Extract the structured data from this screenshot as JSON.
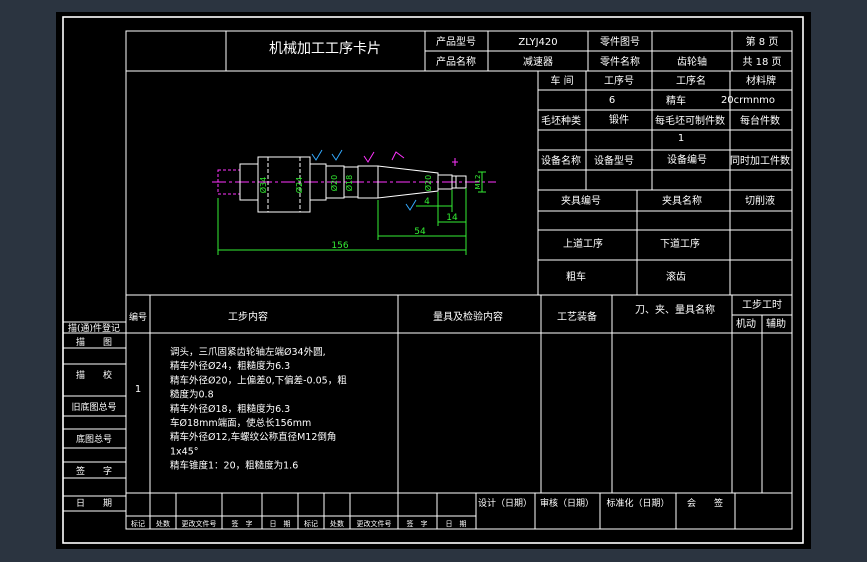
{
  "title": "机械加工工序卡片",
  "header": {
    "product_model_label": "产品型号",
    "product_model_value": "ZLYJ420",
    "part_no_label": "零件图号",
    "part_no_value": "",
    "sheet_label": "第 8 页",
    "product_name_label": "产品名称",
    "product_name_value": "减速器",
    "part_name_label": "零件名称",
    "part_name_value": "齿轮轴",
    "total_label": "共 18 页"
  },
  "process_info": {
    "workshop_label": "车 间",
    "op_no_label": "工序号",
    "op_name_label": "工序名",
    "material_label": "材料牌",
    "workshop_value": "",
    "op_no_value": "6",
    "op_name_value": "精车",
    "material_value": "20crmnmo",
    "blank_type_label": "毛坯种类",
    "blank_type_value": "锻件",
    "parts_per_blank_label": "每毛坯可制件数",
    "parts_per_blank_value": "1",
    "per_unit_label": "每台件数",
    "equip_name_label": "设备名称",
    "equip_model_label": "设备型号",
    "equip_no_label": "设备编号",
    "simul_label": "同时加工件数",
    "fixture_no_label": "夹具编号",
    "fixture_name_label": "夹具名称",
    "coolant_label": "切削液",
    "prev_op_label": "上道工序",
    "next_op_label": "下道工序",
    "prev_op_value": "粗车",
    "next_op_value": "滚齿"
  },
  "drawing": {
    "dims": [
      "Ø34",
      "Ø24",
      "Ø20",
      "Ø18",
      "Ø20",
      "M12",
      "156",
      "54",
      "14",
      "4"
    ]
  },
  "step_table": {
    "headers": {
      "no": "编号",
      "content": "工步内容",
      "inspect": "量具及检验内容",
      "equipment": "工艺装备",
      "tools": "刀、夹、量具名称",
      "hours": "工步工时",
      "machine": "机动",
      "aux": "辅助"
    },
    "step_no": "1",
    "lines": [
      "调头，三爪固紧齿轮轴左端Ø34外圆,",
      "精车外径Ø24，粗糙度为6.3",
      "精车外径Ø20，上偏差0,下偏差-0.05，粗",
      "糙度为0.8",
      "精车外径Ø18，粗糙度为6.3",
      "车Ø18mm端面，使总长156mm",
      "精车外径Ø12,车螺纹公称直径M12倒角",
      "1x45°",
      "精车锥度1：20，粗糙度为1.6"
    ]
  },
  "left_panel": [
    "描(通)件登记",
    "描　　图",
    "描　　校",
    "旧底图总号",
    "底图总号",
    "签　　字",
    "日　　期"
  ],
  "footer": {
    "design": "设计（日期）",
    "review": "审核（日期）",
    "standard": "标准化（日期）",
    "countersign": "会　　签",
    "row": [
      "标记",
      "处数",
      "更改文件号",
      "签　字",
      "日　期",
      "标记",
      "处数",
      "更改文件号",
      "签　字",
      "日　期"
    ]
  }
}
